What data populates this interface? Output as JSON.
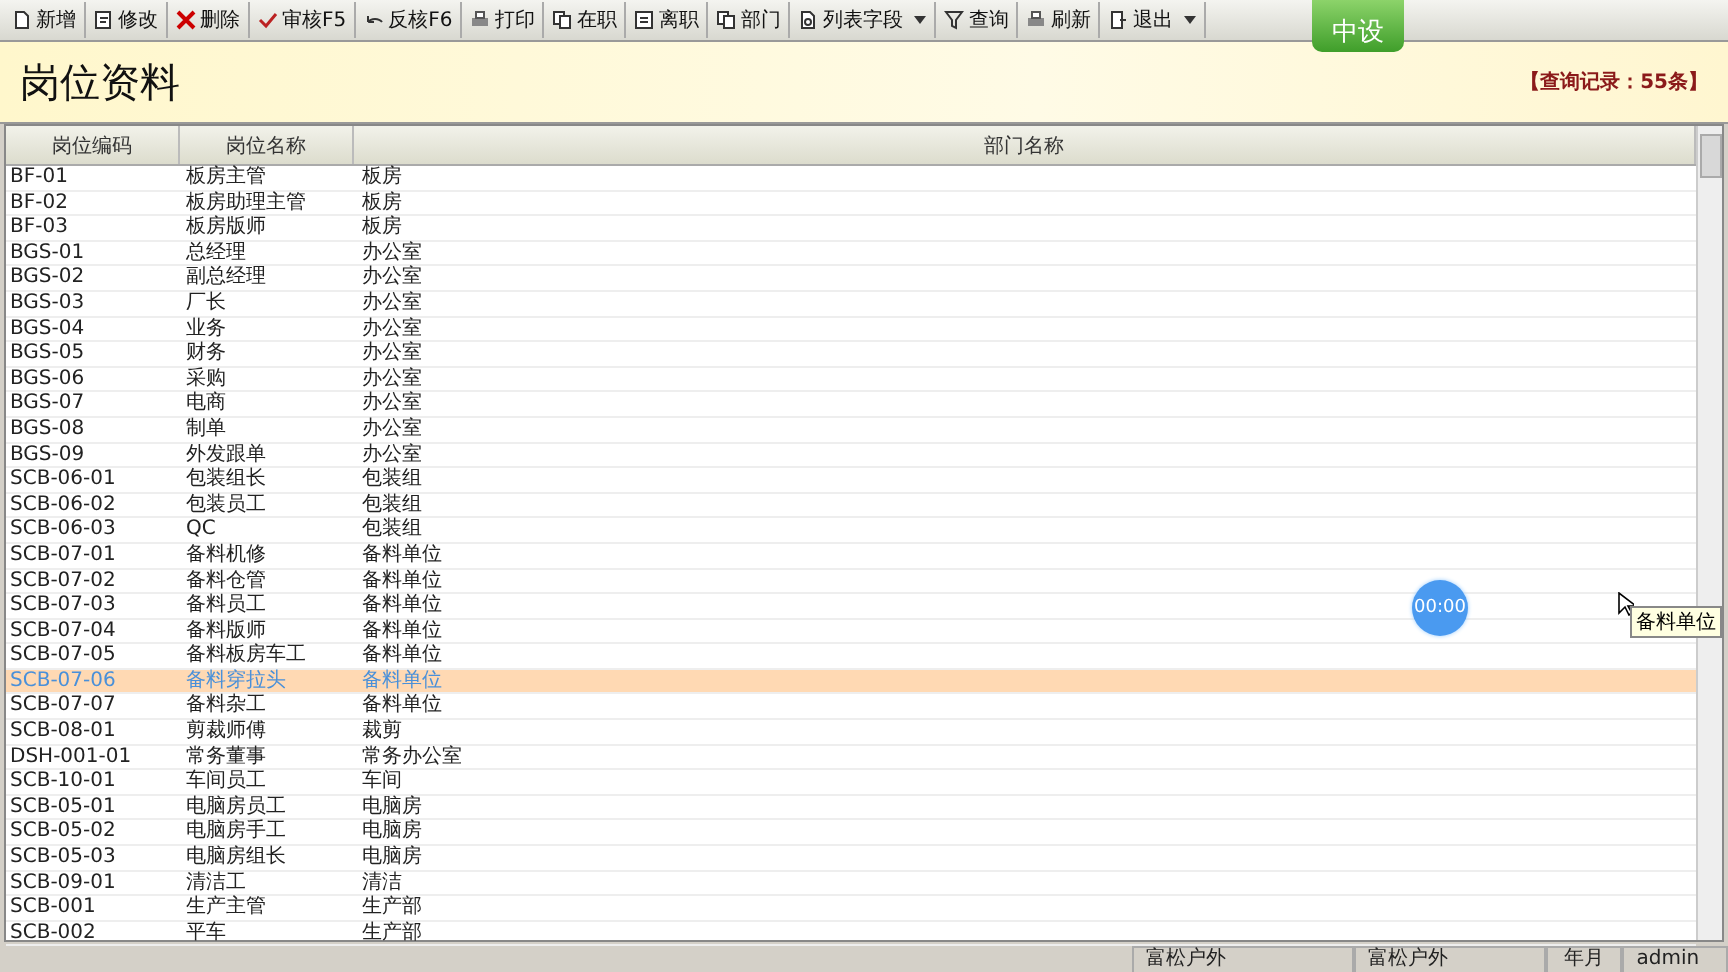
{
  "toolbar": [
    {
      "label": "新增",
      "has_menu": false
    },
    {
      "label": "修改",
      "has_menu": false
    },
    {
      "label": "删除",
      "has_menu": false
    },
    {
      "label": "审核F5",
      "has_menu": false
    },
    {
      "label": "反核F6",
      "has_menu": false
    },
    {
      "label": "打印",
      "has_menu": false
    },
    {
      "label": "在职",
      "has_menu": false
    },
    {
      "label": "离职",
      "has_menu": false
    },
    {
      "label": "部门",
      "has_menu": false
    },
    {
      "label": "列表字段",
      "has_menu": true
    },
    {
      "label": "查询",
      "has_menu": false
    },
    {
      "label": "刷新",
      "has_menu": false
    },
    {
      "label": "退出",
      "has_menu": true
    }
  ],
  "logo": {
    "text": "中设"
  },
  "header": {
    "title": "岗位资料",
    "record_count": "【查询记录：55条】"
  },
  "table": {
    "columns": [
      "岗位编码",
      "岗位名称",
      "部门名称"
    ],
    "rows": [
      {
        "cells": [
          "BF-01",
          "板房主管",
          "板房"
        ],
        "selected": false
      },
      {
        "cells": [
          "BF-02",
          "板房助理主管",
          "板房"
        ],
        "selected": false
      },
      {
        "cells": [
          "BF-03",
          "板房版师",
          "板房"
        ],
        "selected": false
      },
      {
        "cells": [
          "BGS-01",
          "总经理",
          "办公室"
        ],
        "selected": false
      },
      {
        "cells": [
          "BGS-02",
          "副总经理",
          "办公室"
        ],
        "selected": false
      },
      {
        "cells": [
          "BGS-03",
          "厂长",
          "办公室"
        ],
        "selected": false
      },
      {
        "cells": [
          "BGS-04",
          "业务",
          "办公室"
        ],
        "selected": false
      },
      {
        "cells": [
          "BGS-05",
          "财务",
          "办公室"
        ],
        "selected": false
      },
      {
        "cells": [
          "BGS-06",
          "采购",
          "办公室"
        ],
        "selected": false
      },
      {
        "cells": [
          "BGS-07",
          "电商",
          "办公室"
        ],
        "selected": false
      },
      {
        "cells": [
          "BGS-08",
          "制单",
          "办公室"
        ],
        "selected": false
      },
      {
        "cells": [
          "BGS-09",
          "外发跟单",
          "办公室"
        ],
        "selected": false
      },
      {
        "cells": [
          "SCB-06-01",
          "包装组长",
          "包装组"
        ],
        "selected": false
      },
      {
        "cells": [
          "SCB-06-02",
          "包装员工",
          "包装组"
        ],
        "selected": false
      },
      {
        "cells": [
          "SCB-06-03",
          "QC",
          "包装组"
        ],
        "selected": false
      },
      {
        "cells": [
          "SCB-07-01",
          "备料机修",
          "备料单位"
        ],
        "selected": false
      },
      {
        "cells": [
          "SCB-07-02",
          "备料仓管",
          "备料单位"
        ],
        "selected": false
      },
      {
        "cells": [
          "SCB-07-03",
          "备料员工",
          "备料单位"
        ],
        "selected": false
      },
      {
        "cells": [
          "SCB-07-04",
          "备料版师",
          "备料单位"
        ],
        "selected": false
      },
      {
        "cells": [
          "SCB-07-05",
          "备料板房车工",
          "备料单位"
        ],
        "selected": false
      },
      {
        "cells": [
          "SCB-07-06",
          "备料穿拉头",
          "备料单位"
        ],
        "selected": true
      },
      {
        "cells": [
          "SCB-07-07",
          "备料杂工",
          "备料单位"
        ],
        "selected": false
      },
      {
        "cells": [
          "SCB-08-01",
          "剪裁师傅",
          "裁剪"
        ],
        "selected": false
      },
      {
        "cells": [
          "DSH-001-01",
          "常务董事",
          "常务办公室"
        ],
        "selected": false
      },
      {
        "cells": [
          "SCB-10-01",
          "车间员工",
          "车间"
        ],
        "selected": false
      },
      {
        "cells": [
          "SCB-05-01",
          "电脑房员工",
          "电脑房"
        ],
        "selected": false
      },
      {
        "cells": [
          "SCB-05-02",
          "电脑房手工",
          "电脑房"
        ],
        "selected": false
      },
      {
        "cells": [
          "SCB-05-03",
          "电脑房组长",
          "电脑房"
        ],
        "selected": false
      },
      {
        "cells": [
          "SCB-09-01",
          "清洁工",
          "清洁"
        ],
        "selected": false
      },
      {
        "cells": [
          "SCB-001",
          "生产主管",
          "生产部"
        ],
        "selected": false
      },
      {
        "cells": [
          "SCB-002",
          "平车",
          "生产部"
        ],
        "selected": false
      }
    ]
  },
  "timer": {
    "text": "00:00"
  },
  "tooltip": {
    "text": "备料单位"
  },
  "status_bar": [
    "富松户外",
    "富松户外",
    "年月",
    "admin"
  ]
}
